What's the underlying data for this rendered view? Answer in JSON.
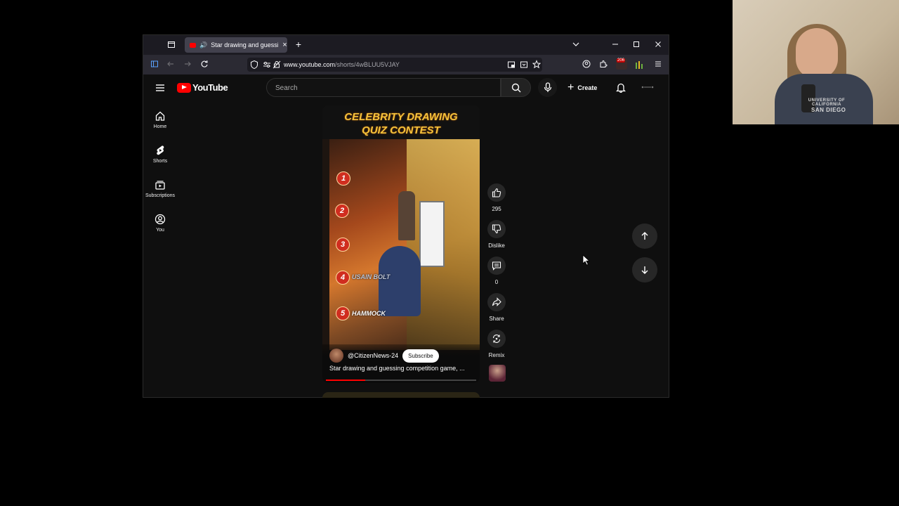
{
  "browser": {
    "tab_title": "Star drawing and guessing",
    "url_domain": "www.youtube.com",
    "url_path": "/shorts/4wBLUU5VJAY",
    "new_tab_label": "+",
    "extension_badge": "206"
  },
  "youtube": {
    "logo_text": "YouTube",
    "search_placeholder": "Search",
    "create_label": "Create",
    "sidebar": [
      {
        "label": "Home",
        "icon": "home-icon"
      },
      {
        "label": "Shorts",
        "icon": "shorts-icon"
      },
      {
        "label": "Subscriptions",
        "icon": "subscriptions-icon"
      },
      {
        "label": "You",
        "icon": "you-icon"
      }
    ],
    "short": {
      "banner_line1": "CELEBRITY DRAWING",
      "banner_line2": "QUIZ CONTEST",
      "overlay_numbers": [
        "1",
        "2",
        "3",
        "4",
        "5"
      ],
      "overlay_label_4": "USAIN BOLT",
      "overlay_label_5": "HAMMOCK",
      "channel": "@CitizenNews-24",
      "subscribe_label": "Subscribe",
      "title": "Star drawing and guessing competition game, ...",
      "progress": 0.26
    },
    "actions": {
      "like_count": "295",
      "dislike_label": "Dislike",
      "comments_count": "0",
      "share_label": "Share",
      "remix_label": "Remix"
    }
  },
  "webcam": {
    "shirt_text_line1": "UNIVERSITY OF CALIFORNIA",
    "shirt_text_line2": "SAN DIEGO"
  },
  "colors": {
    "yt_red": "#ff0000",
    "background": "#0f0f0f",
    "banner_gold": "#f5c33b"
  }
}
